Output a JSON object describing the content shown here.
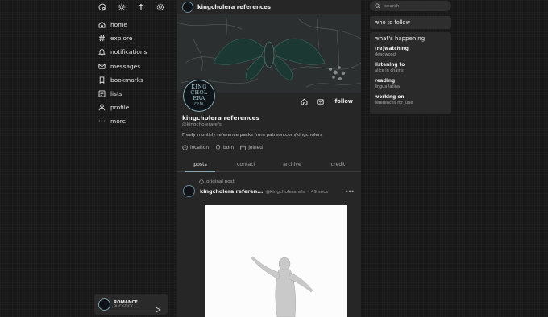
{
  "top_icons": [
    "palette-icon",
    "sun-icon",
    "arrow-up-icon",
    "gear-icon"
  ],
  "nav": {
    "items": [
      {
        "label": "home",
        "icon": "home-icon"
      },
      {
        "label": "explore",
        "icon": "hash-icon"
      },
      {
        "label": "notifications",
        "icon": "bell-icon"
      },
      {
        "label": "messages",
        "icon": "mail-icon"
      },
      {
        "label": "bookmarks",
        "icon": "bookmark-icon"
      },
      {
        "label": "lists",
        "icon": "list-icon"
      },
      {
        "label": "profile",
        "icon": "user-icon"
      },
      {
        "label": "more",
        "icon": "dots-icon"
      }
    ]
  },
  "player": {
    "title": "ROMANCE",
    "artist": "BUCK-TICK"
  },
  "header": {
    "name": "kingcholera references"
  },
  "profile": {
    "avatar_text": [
      "KING",
      "CHOL",
      "ERA",
      "refs"
    ],
    "name": "kingcholera references",
    "handle": "@kingcholerarefs",
    "bio": "Freely monthly reference packs from patreon.com/kingcholera",
    "meta": {
      "location": "location",
      "born": "born",
      "joined": "joined"
    },
    "follow_label": "follow"
  },
  "tabs": [
    "posts",
    "contact",
    "archive",
    "credit"
  ],
  "post": {
    "repost_label": "original post",
    "author": "kingcholera referen...",
    "handle": "@kingcholerarefs",
    "sep": "·",
    "time": "49 secs"
  },
  "search": {
    "placeholder": "search"
  },
  "who_to_follow": "who to follow",
  "happening": {
    "title": "what's happening",
    "items": [
      {
        "k": "(re)watching",
        "v": "deadwood"
      },
      {
        "k": "listening to",
        "v": "alice in chains"
      },
      {
        "k": "reading",
        "v": "lingua latina"
      },
      {
        "k": "working on",
        "v": "references for june"
      }
    ]
  },
  "colors": {
    "accent": "#8aa8b4",
    "bg": "#171717",
    "panel": "#262626"
  }
}
